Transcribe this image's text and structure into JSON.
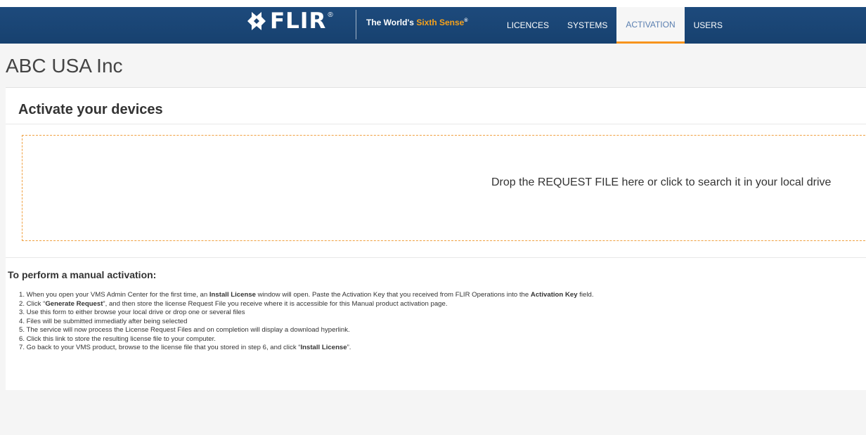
{
  "header": {
    "brand": "FLIR",
    "brand_mark": "®",
    "tagline_prefix": "The World's ",
    "tagline_accent": "Sixth Sense",
    "tagline_mark": "®",
    "nav": [
      {
        "label": "LICENCES",
        "active": false
      },
      {
        "label": "SYSTEMS",
        "active": false
      },
      {
        "label": "ACTIVATION",
        "active": true
      },
      {
        "label": "USERS",
        "active": false
      }
    ]
  },
  "page": {
    "company": "ABC USA Inc",
    "section_title": "Activate your devices",
    "dropzone_text": "Drop the REQUEST FILE here or click to search it in your local drive",
    "instructions_title": "To perform a manual activation:"
  },
  "steps": {
    "s1": {
      "a": "1. When you open your VMS Admin Center for the first time, an ",
      "b": "Install License",
      "c": " window will open. Paste the Activation Key that you received from FLIR Operations into the ",
      "d": "Activation Key",
      "e": " field."
    },
    "s2": {
      "a": "2. Click “",
      "b": "Generate Request",
      "c": "”, and then store the license Request File you receive where it is accessible for this Manual product activation page."
    },
    "s3": "3. Use this form to either browse your local drive or drop one or several files",
    "s4": "4. Files will be submitted immediatly after being selected",
    "s5": "5. The service will now process the License Request Files and on completion will display a download hyperlink.",
    "s6": "6. Click this link to store the resulting license file to your computer.",
    "s7": {
      "a": "7. Go back to your VMS product, browse to the license file that you stored in step 6, and click “",
      "b": "Install License",
      "c": "”."
    }
  },
  "colors": {
    "header_bg": "#1a4577",
    "accent_orange": "#f7941d",
    "active_tab_text": "#5a7fb0"
  }
}
